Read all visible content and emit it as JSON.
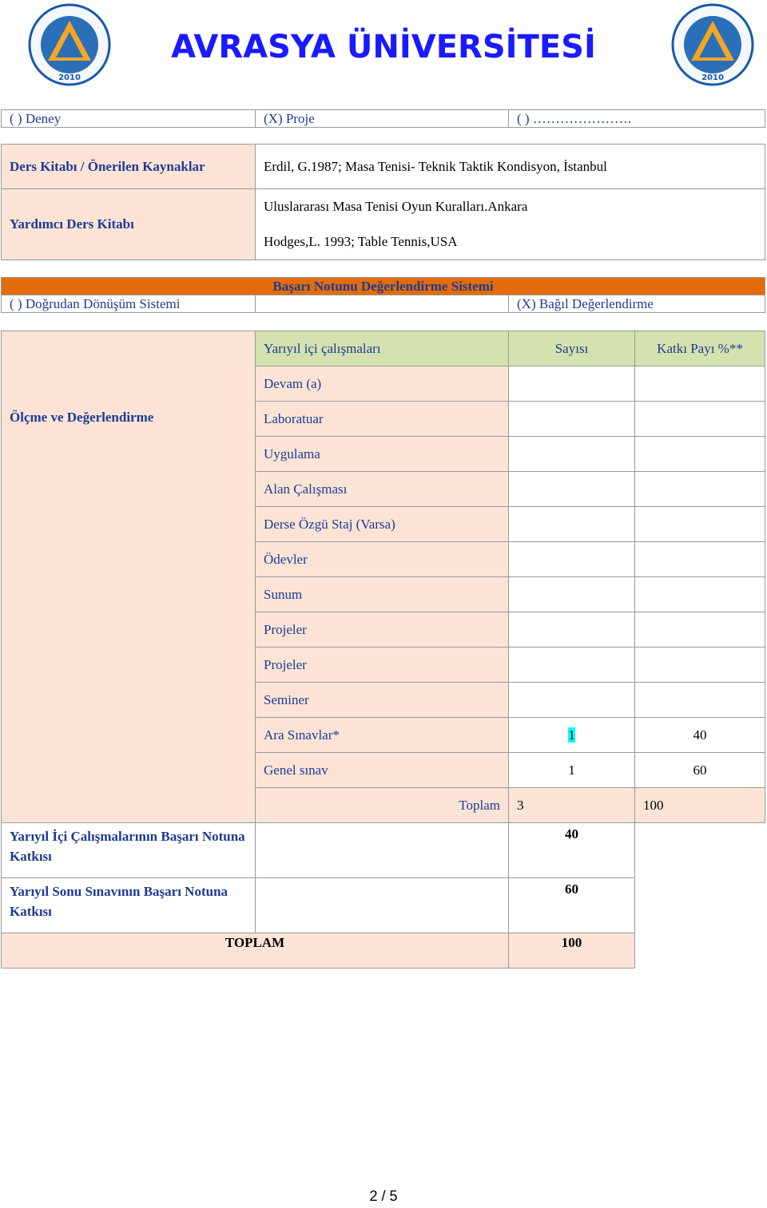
{
  "header": {
    "title": "AVRASYA ÜNİVERSİTESİ",
    "logo_top_text": "ÜNİVERSİTESİ",
    "logo_side_text": "AVRASYA",
    "logo_year": "2010"
  },
  "type_row": {
    "deney": "( ) Deney",
    "proje": "(X) Proje",
    "other": "( ) …………………."
  },
  "books": {
    "main_label": "Ders Kitabı / Önerilen Kaynaklar",
    "main_value": "Erdil, G.1987; Masa Tenisi- Teknik Taktik Kondisyon, İstanbul",
    "aux_label": "Yardımcı Ders Kitabı",
    "aux_value_1": "Uluslararası Masa Tenisi Oyun Kuralları.Ankara",
    "aux_value_2": "Hodges,L. 1993; Table Tennis,USA"
  },
  "grading_system": {
    "title": "Başarı Notunu Değerlendirme Sistemi",
    "direct": "( ) Doğrudan Dönüşüm Sistemi",
    "relative": "(X) Bağıl Değerlendirme"
  },
  "assessment": {
    "section_label": "Ölçme ve Değerlendirme",
    "headers": [
      "Yarıyıl içi çalışmaları",
      "Sayısı",
      "Katkı Payı %**"
    ],
    "rows": [
      {
        "name": "Devam (a)",
        "count": "",
        "share": ""
      },
      {
        "name": "Laboratuar",
        "count": "",
        "share": ""
      },
      {
        "name": "Uygulama",
        "count": "",
        "share": ""
      },
      {
        "name": "Alan Çalışması",
        "count": "",
        "share": ""
      },
      {
        "name": "Derse Özgü Staj (Varsa)",
        "count": "",
        "share": ""
      },
      {
        "name": "Ödevler",
        "count": "",
        "share": ""
      },
      {
        "name": "Sunum",
        "count": "",
        "share": ""
      },
      {
        "name": "Projeler",
        "count": "",
        "share": ""
      },
      {
        "name": "Projeler",
        "count": "",
        "share": ""
      },
      {
        "name": "Seminer",
        "count": "",
        "share": ""
      },
      {
        "name": "Ara Sınavlar*",
        "count": "1",
        "share": "40"
      },
      {
        "name": "Genel sınav",
        "count": "1",
        "share": "60"
      }
    ],
    "total_label": "Toplam",
    "total_count": "3",
    "total_share": "100",
    "midterm_contrib_label": "Yarıyıl İçi Çalışmalarının Başarı Notuna Katkısı",
    "midterm_contrib_value": "40",
    "final_contrib_label": "Yarıyıl Sonu Sınavının Başarı Notuna Katkısı",
    "final_contrib_value": "60",
    "grand_total_label": "TOPLAM",
    "grand_total_value": "100"
  },
  "footer": {
    "page": "2 / 5"
  }
}
